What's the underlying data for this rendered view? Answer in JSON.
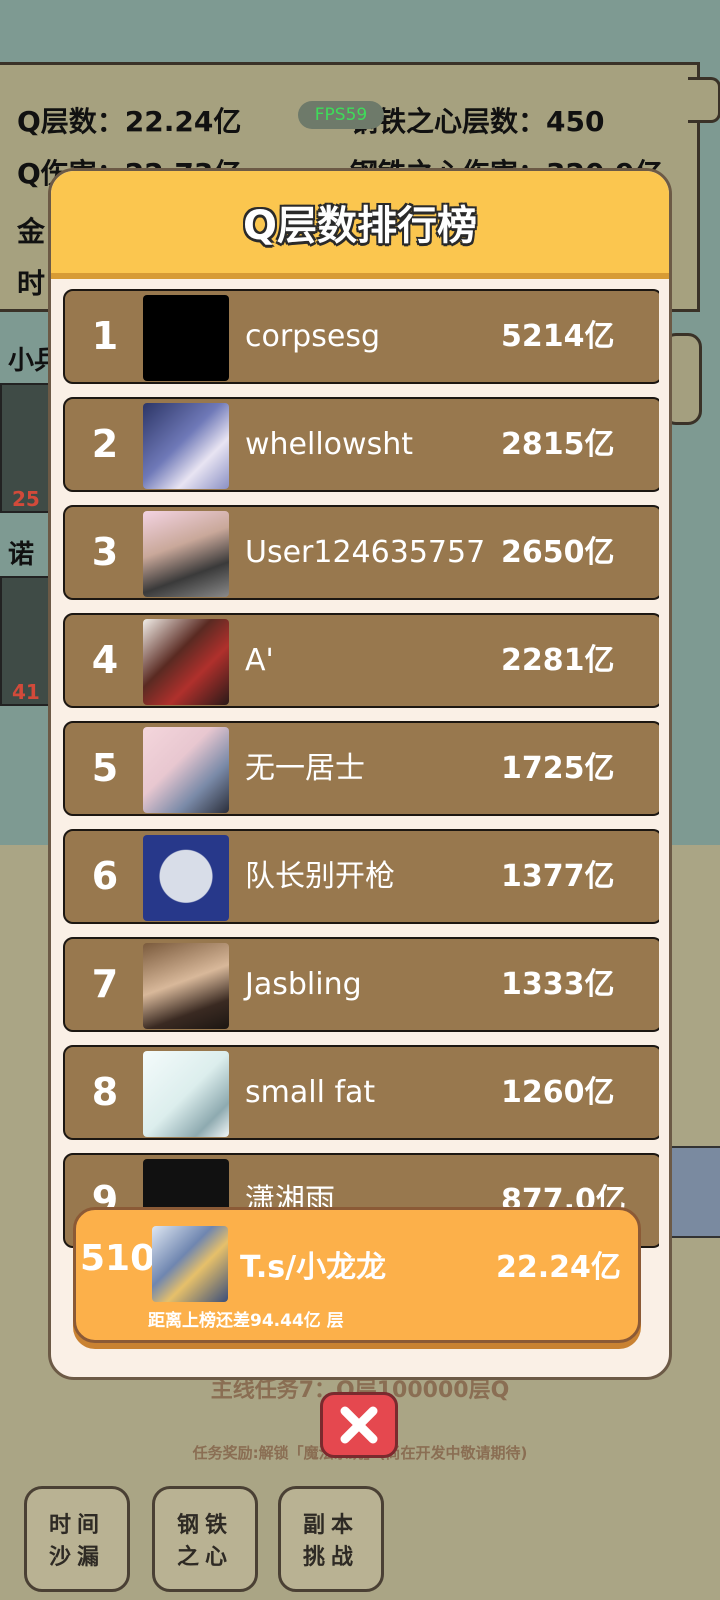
{
  "stats": {
    "q_layers": "Q层数：22.24亿",
    "steel_layers": "钢铁之心层数：450",
    "q_damage_partial": "Q伤害：22.73亿",
    "steel_damage_partial": "钢铁之心伤害：320.9亿",
    "gold_partial": "金",
    "time_partial": "时",
    "fps": "FPS59"
  },
  "side": {
    "label1": "小兵",
    "label2": "诺",
    "card1_num": "25",
    "card2_num": "41"
  },
  "leaderboard": {
    "title": "Q层数排行榜",
    "entries": [
      {
        "rank": "1",
        "name": "corpsesg",
        "score": "5214亿"
      },
      {
        "rank": "2",
        "name": "whellowsht",
        "score": "2815亿"
      },
      {
        "rank": "3",
        "name": "User124635757",
        "score": "2650亿"
      },
      {
        "rank": "4",
        "name": "A'",
        "score": "2281亿"
      },
      {
        "rank": "5",
        "name": "无一居士",
        "score": "1725亿"
      },
      {
        "rank": "6",
        "name": "队长别开枪",
        "score": "1377亿"
      },
      {
        "rank": "7",
        "name": "Jasbling",
        "score": "1333亿"
      },
      {
        "rank": "8",
        "name": "small fat",
        "score": "1260亿"
      },
      {
        "rank": "9",
        "name": "潇湘雨",
        "score": "877.0亿"
      }
    ],
    "self": {
      "rank": "510",
      "name": "T.s/小龙龙",
      "score": "22.24亿",
      "hint": "距离上榜还差94.44亿 层"
    }
  },
  "mission": {
    "line1": "主线任务7：Q层100000层Q",
    "reward": "任务奖励:解锁「魔法系统」(尚在开发中敬请期待)"
  },
  "buttons": {
    "time_hourglass": [
      "时间",
      "沙漏"
    ],
    "steel_heart": [
      "钢铁",
      "之心"
    ],
    "dungeon_challenge": [
      "副本",
      "挑战"
    ]
  },
  "icons": {
    "close": "close-x-icon"
  }
}
